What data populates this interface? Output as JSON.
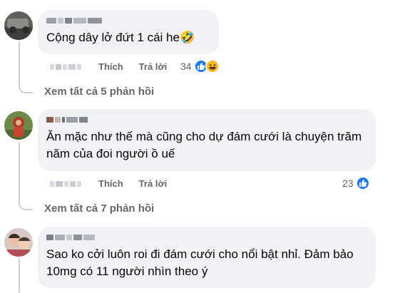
{
  "comments": [
    {
      "text": "Cộng dây lở đứt 1 cái he🤣",
      "like_label": "Thích",
      "reply_label": "Trả lời",
      "reaction_count": "34",
      "reactions": [
        "like-icon",
        "haha-icon"
      ],
      "view_replies": "Xem tất cả 5 phản hồi"
    },
    {
      "text": "Ăn mặc như thế mà cũng cho dự đám cưới là chuyện trăm năm của đoi người ồ uế",
      "like_label": "Thích",
      "reply_label": "Trả lời",
      "reaction_count": "23",
      "reactions": [
        "like-icon"
      ],
      "view_replies": "Xem tất cả 7 phản hồi"
    },
    {
      "text": "Sao ko cởi luôn roi đi đám cưới cho nổi bật nhỉ. Đảm bảo 10mg có 11 người nhìn theo ý"
    }
  ],
  "colors": {
    "bubble": "#f0f2f5",
    "secondary_text": "#65676b",
    "like_blue": "#1877f2",
    "haha_yellow": "#f7b928",
    "thread_line": "#ced0d4"
  }
}
